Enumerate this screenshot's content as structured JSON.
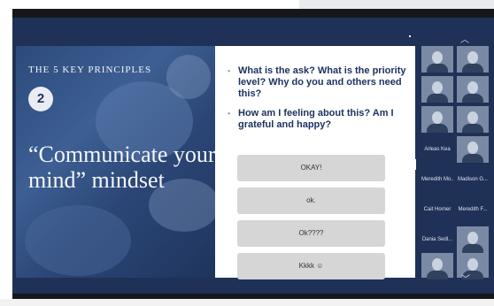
{
  "slide": {
    "kicker": "THE 5 KEY PRINCIPLES",
    "number": "2",
    "heading": "“Communicate your mind” mindset"
  },
  "panel": {
    "bullets": [
      "What is the ask? What is the priority level? Why do you and others need this?",
      "How am I feeling about this? Am I grateful and happy?"
    ],
    "replies": [
      "OKAY!",
      "ok.",
      "Ok????",
      "Kkkk ☺"
    ]
  },
  "gallery": {
    "names": [
      "Arleas Kea",
      "Meredith Mo...",
      "Madison G...",
      "Cait Horner",
      "Meredith F...",
      "Dania Sedl..."
    ]
  },
  "icons": {
    "scroll_up": "chevron-up-icon",
    "scroll_down": "chevron-down-icon"
  }
}
